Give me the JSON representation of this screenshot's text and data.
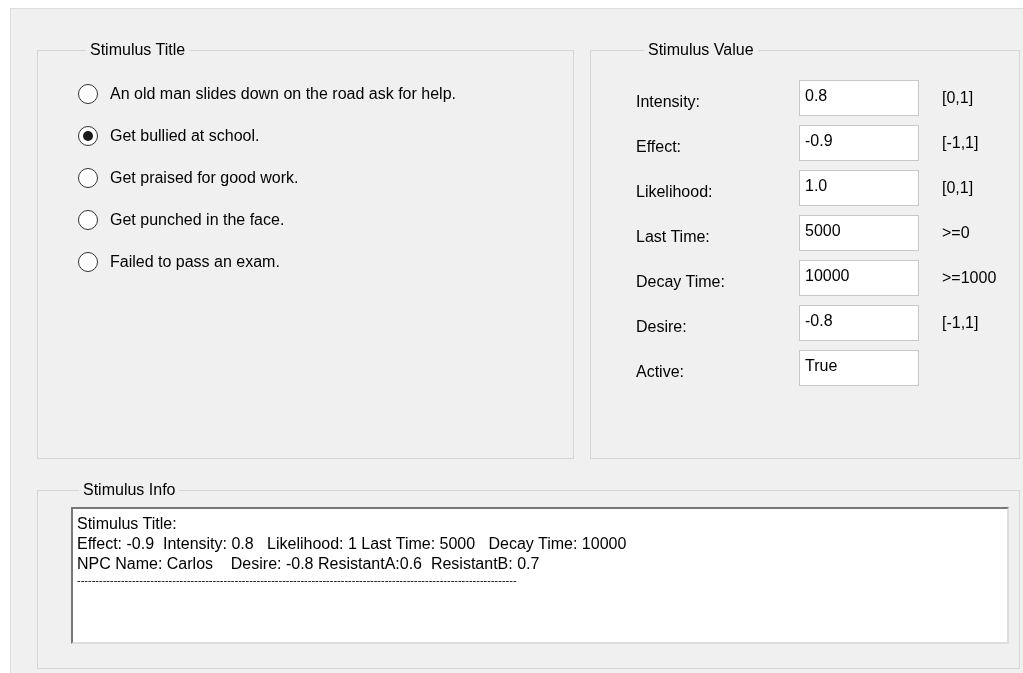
{
  "title_group": {
    "legend": "Stimulus Title",
    "options": [
      {
        "label": "An old man slides down on the road ask for help.",
        "selected": false
      },
      {
        "label": "Get bullied at school.",
        "selected": true
      },
      {
        "label": "Get praised for good work.",
        "selected": false
      },
      {
        "label": "Get punched in the face.",
        "selected": false
      },
      {
        "label": "Failed to pass an exam.",
        "selected": false
      }
    ]
  },
  "value_group": {
    "legend": "Stimulus Value",
    "fields": [
      {
        "label": "Intensity:",
        "value": "0.8",
        "range": "[0,1]"
      },
      {
        "label": "Effect:",
        "value": "-0.9",
        "range": "[-1,1]"
      },
      {
        "label": "Likelihood:",
        "value": "1.0",
        "range": "[0,1]"
      },
      {
        "label": "Last Time:",
        "value": "5000",
        "range": ">=0"
      },
      {
        "label": "Decay Time:",
        "value": "10000",
        "range": ">=1000"
      },
      {
        "label": "Desire:",
        "value": "-0.8",
        "range": "[-1,1]"
      },
      {
        "label": "Active:",
        "value": "True"
      }
    ]
  },
  "info_group": {
    "legend": "Stimulus Info",
    "lines": [
      "Stimulus Title:",
      "Effect: -0.9  Intensity: 0.8   Likelihood: 1 Last Time: 5000   Decay Time: 10000",
      "NPC Name: Carlos    Desire: -0.8 ResistantA:0.6  ResistantB: 0.7",
      "------------------------------------------------------------------------------------------------------------------------"
    ]
  }
}
